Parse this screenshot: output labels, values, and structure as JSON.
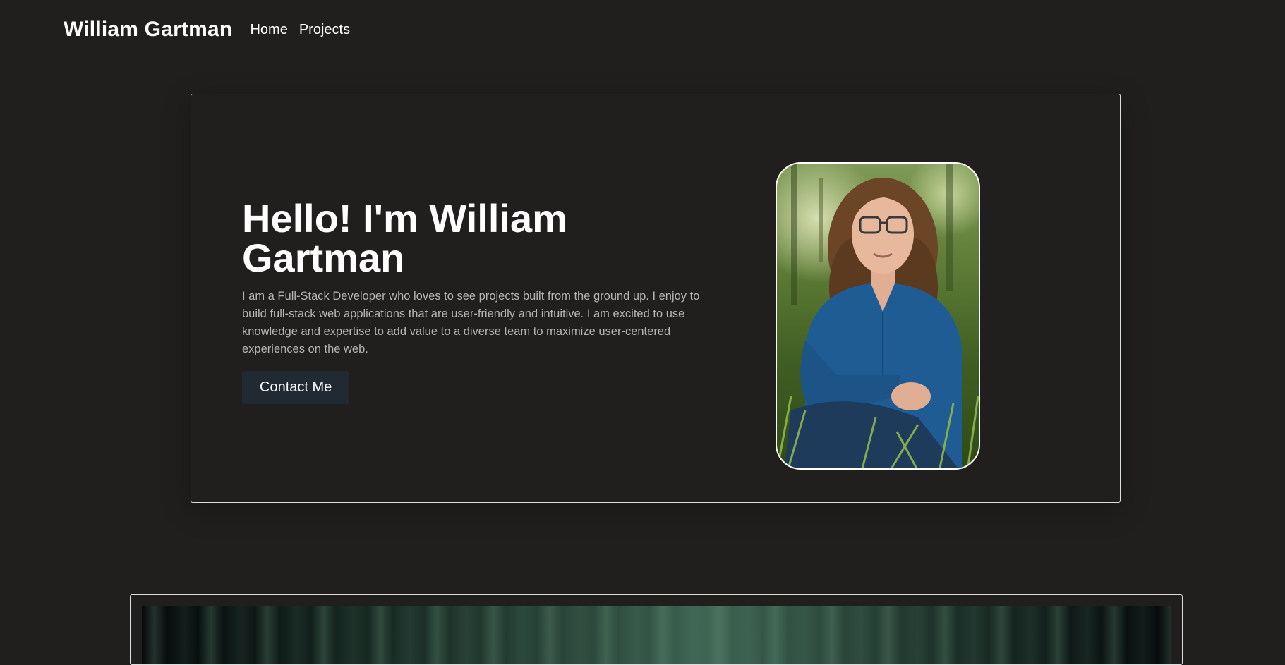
{
  "nav": {
    "brand": "William Gartman",
    "links": [
      "Home",
      "Projects"
    ]
  },
  "hero": {
    "title": "Hello! I'm William Gartman",
    "description": "I am a Full-Stack Developer who loves to see projects built from the ground up. I enjoy to build full-stack web applications that are user-friendly and intuitive. I am excited to use knowledge and expertise to add value to a diverse team to maximize user-centered experiences on the web.",
    "button_label": "Contact Me"
  },
  "colors": {
    "background": "#201f1d",
    "button_bg": "#212a33",
    "card_border": "#dddddd",
    "body_text": "#b4b4b4"
  }
}
